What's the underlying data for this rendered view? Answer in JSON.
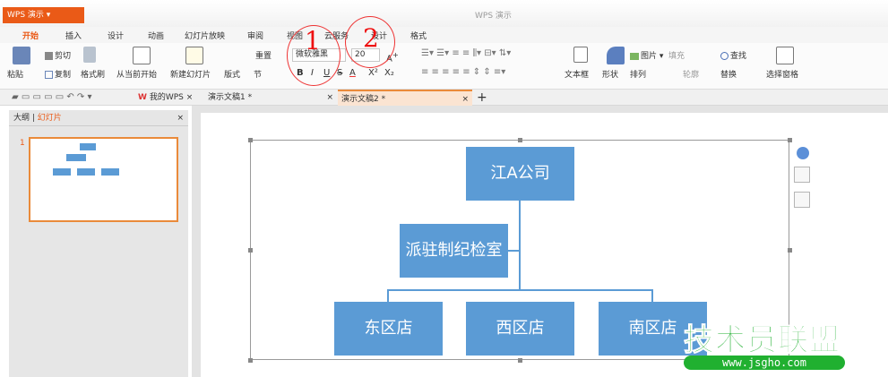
{
  "app": {
    "button_label": "WPS 演示",
    "title": "WPS 演示"
  },
  "tabs": [
    "开始",
    "插入",
    "设计",
    "动画",
    "幻灯片放映",
    "审阅",
    "视图",
    "云服务",
    "设计",
    "格式"
  ],
  "ribbon": {
    "paste": "粘贴",
    "cut": "剪切",
    "copy": "复制",
    "format_painter": "格式刷",
    "from_current": "从当前开始",
    "new_slide": "新建幻灯片",
    "layout": "版式",
    "section": "节",
    "reset": "重置",
    "font_name": "微软雅黑",
    "font_size": "20",
    "bold": "B",
    "italic": "I",
    "underline": "U",
    "strike": "S",
    "color": "A",
    "superscript": "X²",
    "subscript": "X₂",
    "textbox": "文本框",
    "shape": "形状",
    "picture": "图片",
    "fill": "填充",
    "arrange": "排列",
    "outline": "轮廓",
    "find": "查找",
    "replace": "替换",
    "select_pane": "选择窗格"
  },
  "doctabs": {
    "mywps": "我的WPS",
    "doc1": "演示文稿1 *",
    "doc2": "演示文稿2 *"
  },
  "sidebar": {
    "outline": "大纲",
    "slides": "幻灯片",
    "slide_number": "1"
  },
  "org": {
    "top": "江A公司",
    "assistant": "派驻制纪检室",
    "east": "东区店",
    "west": "西区店",
    "south": "南区店"
  },
  "annotations": {
    "one": "1",
    "two": "2"
  },
  "watermark": {
    "title": "技术员联盟",
    "url": "www.jsgho.com"
  }
}
